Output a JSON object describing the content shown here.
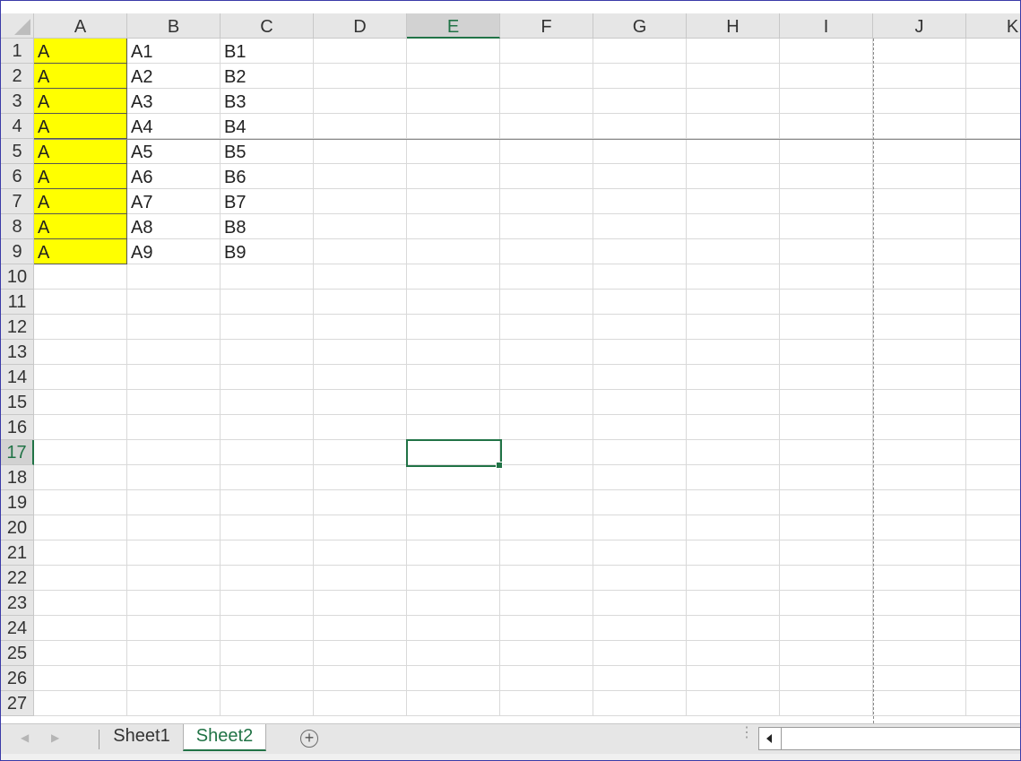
{
  "spreadsheet": {
    "columns": [
      "A",
      "B",
      "C",
      "D",
      "E",
      "F",
      "G",
      "H",
      "I",
      "J",
      "K"
    ],
    "rows": [
      "1",
      "2",
      "3",
      "4",
      "5",
      "6",
      "7",
      "8",
      "9",
      "10",
      "11",
      "12",
      "13",
      "14",
      "15",
      "16",
      "17",
      "18",
      "19",
      "20",
      "21",
      "22",
      "23",
      "24",
      "25",
      "26",
      "27"
    ],
    "selected_column": "E",
    "selected_row": "17",
    "cells": [
      {
        "row": 1,
        "col": "A",
        "value": "A",
        "highlight": true
      },
      {
        "row": 2,
        "col": "A",
        "value": "A",
        "highlight": true
      },
      {
        "row": 3,
        "col": "A",
        "value": "A",
        "highlight": true
      },
      {
        "row": 4,
        "col": "A",
        "value": "A",
        "highlight": true
      },
      {
        "row": 5,
        "col": "A",
        "value": "A",
        "highlight": true
      },
      {
        "row": 6,
        "col": "A",
        "value": "A",
        "highlight": true
      },
      {
        "row": 7,
        "col": "A",
        "value": "A",
        "highlight": true
      },
      {
        "row": 8,
        "col": "A",
        "value": "A",
        "highlight": true
      },
      {
        "row": 9,
        "col": "A",
        "value": "A",
        "highlight": true
      },
      {
        "row": 1,
        "col": "B",
        "value": "A1"
      },
      {
        "row": 2,
        "col": "B",
        "value": "A2"
      },
      {
        "row": 3,
        "col": "B",
        "value": "A3"
      },
      {
        "row": 4,
        "col": "B",
        "value": "A4"
      },
      {
        "row": 5,
        "col": "B",
        "value": "A5"
      },
      {
        "row": 6,
        "col": "B",
        "value": "A6"
      },
      {
        "row": 7,
        "col": "B",
        "value": "A7"
      },
      {
        "row": 8,
        "col": "B",
        "value": "A8"
      },
      {
        "row": 9,
        "col": "B",
        "value": "A9"
      },
      {
        "row": 1,
        "col": "C",
        "value": "B1"
      },
      {
        "row": 2,
        "col": "C",
        "value": "B2"
      },
      {
        "row": 3,
        "col": "C",
        "value": "B3"
      },
      {
        "row": 4,
        "col": "C",
        "value": "B4"
      },
      {
        "row": 5,
        "col": "C",
        "value": "B5"
      },
      {
        "row": 6,
        "col": "C",
        "value": "B6"
      },
      {
        "row": 7,
        "col": "C",
        "value": "B7"
      },
      {
        "row": 8,
        "col": "C",
        "value": "B8"
      },
      {
        "row": 9,
        "col": "C",
        "value": "B9"
      }
    ],
    "highlight_color": "#ffff00",
    "accent_color": "#217346"
  },
  "sheet_tabs": {
    "tabs": [
      {
        "label": "Sheet1",
        "active": false
      },
      {
        "label": "Sheet2",
        "active": true
      }
    ],
    "add_icon": "plus-circle-icon"
  }
}
